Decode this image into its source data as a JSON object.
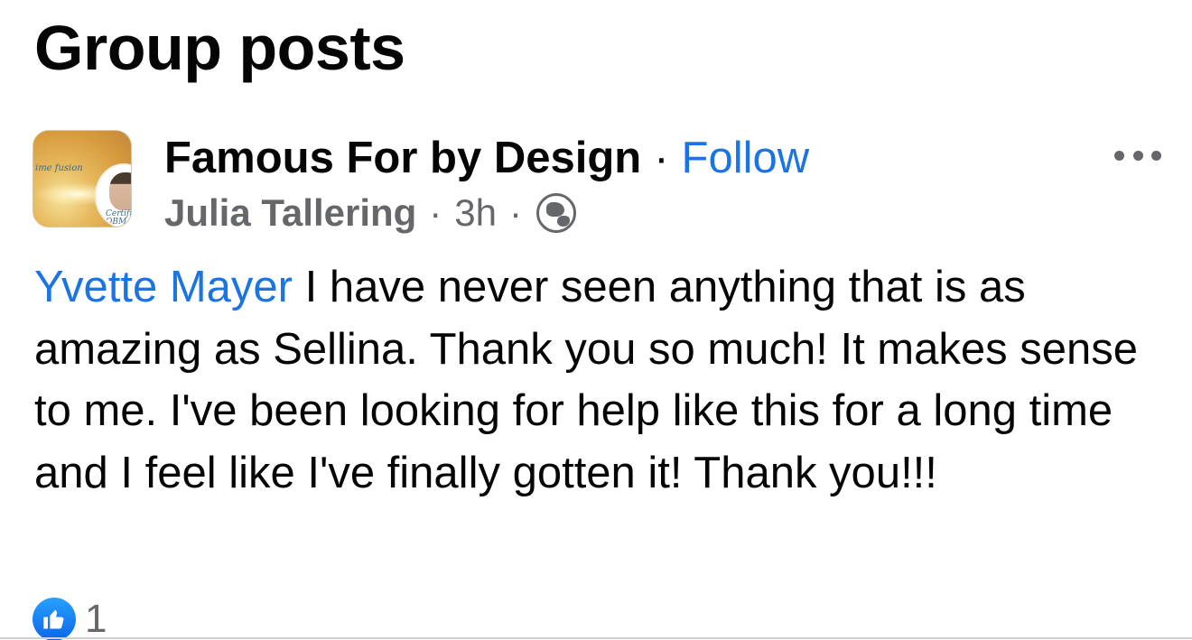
{
  "section": {
    "title": "Group posts"
  },
  "post": {
    "group_name": "Famous For by Design",
    "separator": "·",
    "follow_label": "Follow",
    "author": "Julia Tallering",
    "time": "3h",
    "audience_icon": "globe-icon",
    "mention": "Yvette Mayer",
    "body": "I have never seen anything that is as amazing as Sellina. Thank you so much! It makes sense to me. I've been looking for help like this for a long time and I feel like I've finally gotten it! Thank you!!!",
    "reactions": {
      "icon": "like-icon",
      "count": "1"
    },
    "more_icon": "more-options-icon"
  },
  "colors": {
    "link": "#1b74e4",
    "secondary_text": "#65676b",
    "primary_text": "#050505",
    "like_blue": "#0a66e8"
  }
}
